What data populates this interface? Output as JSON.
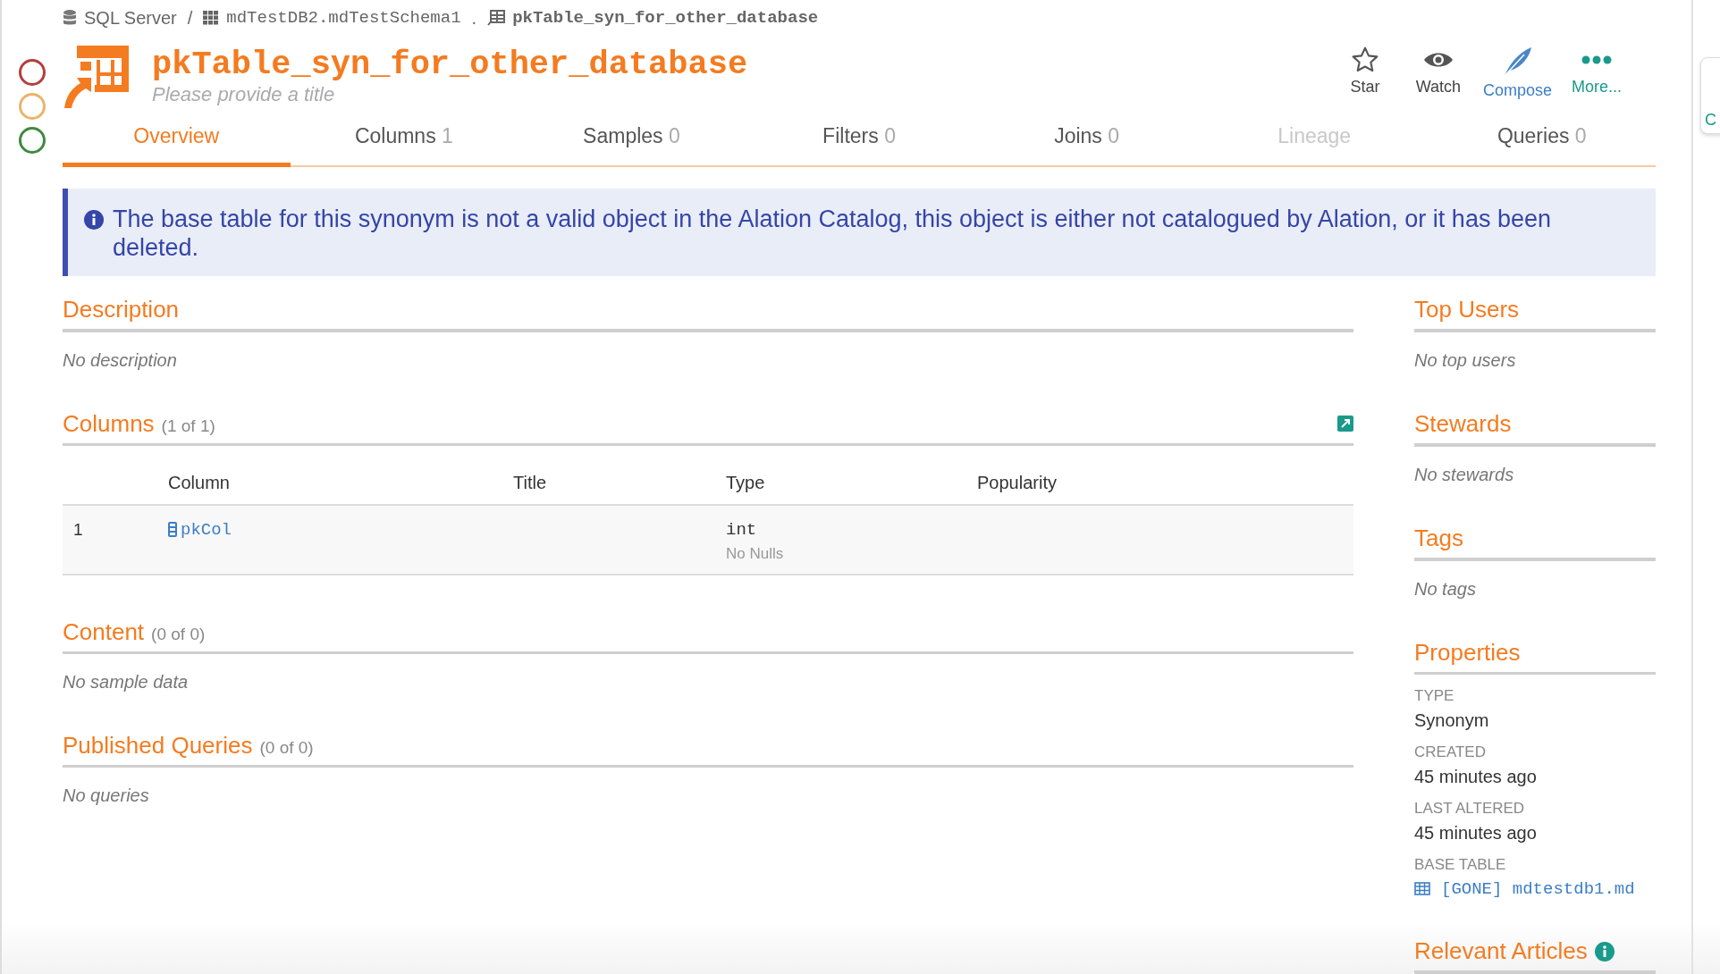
{
  "breadcrumb": [
    {
      "kind": "server",
      "label": "SQL Server",
      "separator": "/"
    },
    {
      "kind": "schema",
      "label": "mdTestDB2.mdTestSchema1",
      "separator": "."
    },
    {
      "kind": "synonym",
      "label": "pkTable_syn_for_other_database"
    }
  ],
  "status_circles": [
    {
      "color": "#b0413e"
    },
    {
      "color": "#eab46a"
    },
    {
      "color": "#3f8a3f"
    }
  ],
  "title": "pkTable_syn_for_other_database",
  "subtitle_placeholder": "Please provide a title",
  "actions": [
    {
      "kind": "star",
      "label": "Star"
    },
    {
      "kind": "watch",
      "label": "Watch"
    },
    {
      "kind": "compose",
      "label": "Compose"
    },
    {
      "kind": "more",
      "label": "More..."
    }
  ],
  "tabs": [
    {
      "label": "Overview",
      "selected": true,
      "disabled": false
    },
    {
      "label": "Columns",
      "count": "1",
      "selected": false,
      "disabled": false
    },
    {
      "label": "Samples",
      "count": "0",
      "selected": false,
      "disabled": false
    },
    {
      "label": "Filters",
      "count": "0",
      "selected": false,
      "disabled": false
    },
    {
      "label": "Joins",
      "count": "0",
      "selected": false,
      "disabled": false
    },
    {
      "label": "Lineage",
      "selected": false,
      "disabled": true
    },
    {
      "label": "Queries",
      "count": "0",
      "selected": false,
      "disabled": false
    }
  ],
  "alert": "The base table for this synonym is not a valid object in the Alation Catalog, this object is either not catalogued by Alation, or it has been deleted.",
  "sections": [
    {
      "kind": "text",
      "title": "Description",
      "empty": "No description"
    },
    {
      "kind": "table",
      "title": "Columns",
      "count": "(1 of 1)",
      "table": {
        "columns": [
          "Column",
          "Title",
          "Type",
          "Popularity"
        ],
        "rows": [
          {
            "index": "1",
            "name": "pkCol",
            "type": "int",
            "nulls": "No Nulls"
          }
        ]
      }
    },
    {
      "kind": "text",
      "title": "Content",
      "count": "(0 of 0)",
      "empty": "No sample data"
    },
    {
      "kind": "text",
      "title": "Published Queries",
      "count": "(0 of 0)",
      "empty": "No queries"
    }
  ],
  "sidebar": [
    {
      "kind": "text",
      "title": "Top Users",
      "empty": "No top users"
    },
    {
      "kind": "text",
      "title": "Stewards",
      "empty": "No stewards"
    },
    {
      "kind": "text",
      "title": "Tags",
      "empty": "No tags"
    },
    {
      "kind": "props",
      "title": "Properties",
      "properties": [
        {
          "label": "TYPE",
          "value": "Synonym"
        },
        {
          "label": "CREATED",
          "value": "45 minutes ago"
        },
        {
          "label": "LAST ALTERED",
          "value": "45 minutes ago"
        },
        {
          "label": "BASE TABLE",
          "value": "[GONE] mdtestdb1.md",
          "kind": "link"
        }
      ]
    },
    {
      "kind": "info",
      "title": "Relevant Articles"
    }
  ],
  "side_card": "C"
}
